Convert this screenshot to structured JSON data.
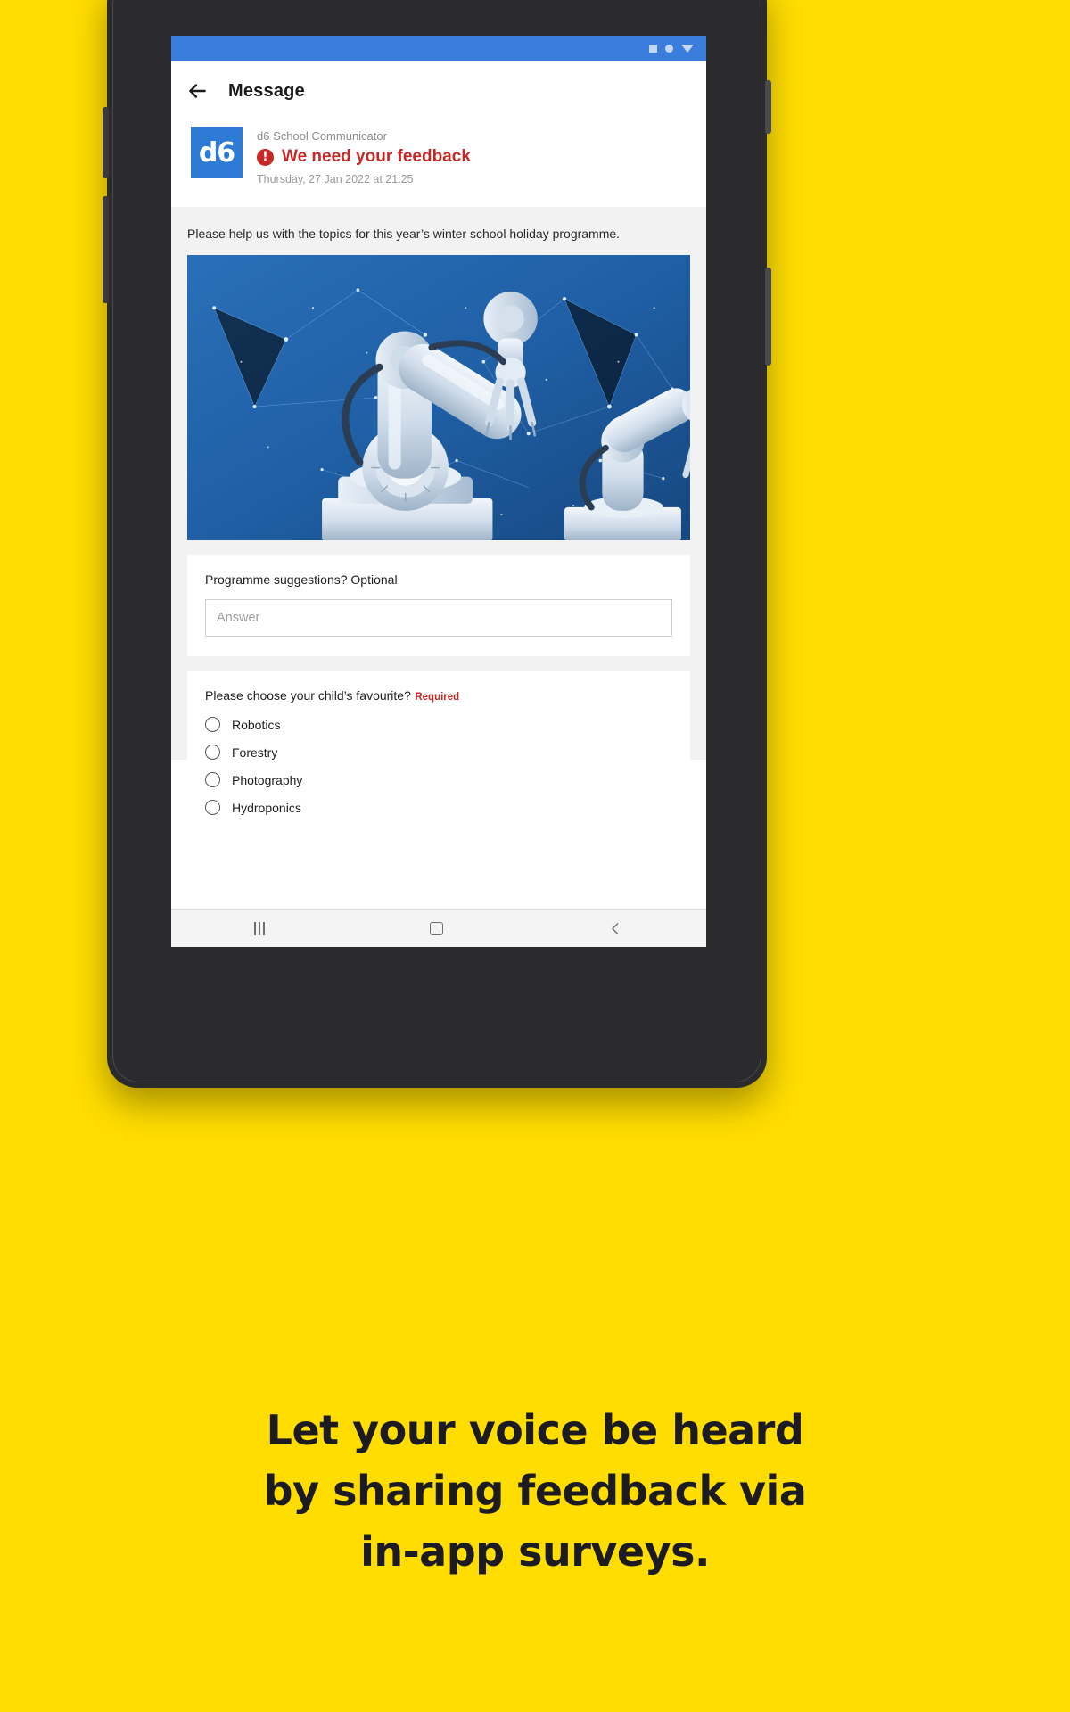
{
  "brand": {
    "bg_yellow": "#FFDD00",
    "accent_blue": "#2E7BD6",
    "alert_red": "#C62828"
  },
  "status_bar": {
    "icons": [
      "square-icon",
      "circle-icon",
      "triangle-down-icon"
    ]
  },
  "app_bar": {
    "back_icon": "back-arrow-icon",
    "title": "Message"
  },
  "message": {
    "logo_text": "d6",
    "sender": "d6 School Communicator",
    "alert_icon": "alert-exclamation-icon",
    "subject": "We need your feedback",
    "date": "Thursday, 27 Jan 2022 at 21:25",
    "body": "Please help us with the topics for this year’s winter school holiday programme.",
    "hero_image_name": "robotic-arms-photo"
  },
  "form": {
    "text_question": {
      "label": "Programme suggestions? Optional",
      "input_value": "",
      "placeholder": "Answer"
    },
    "choice_question": {
      "label": "Please choose your child’s favourite?",
      "required_tag": "Required",
      "options": [
        {
          "label": "Robotics",
          "selected": false
        },
        {
          "label": "Forestry",
          "selected": false
        },
        {
          "label": "Photography",
          "selected": false
        },
        {
          "label": "Hydroponics",
          "selected": false
        }
      ]
    }
  },
  "nav_bar": {
    "recents": "recents-icon",
    "home": "home-icon",
    "back": "back-icon"
  },
  "caption": {
    "line1": "Let your voice be heard",
    "line2": "by sharing feedback via",
    "line3": "in-app surveys."
  }
}
